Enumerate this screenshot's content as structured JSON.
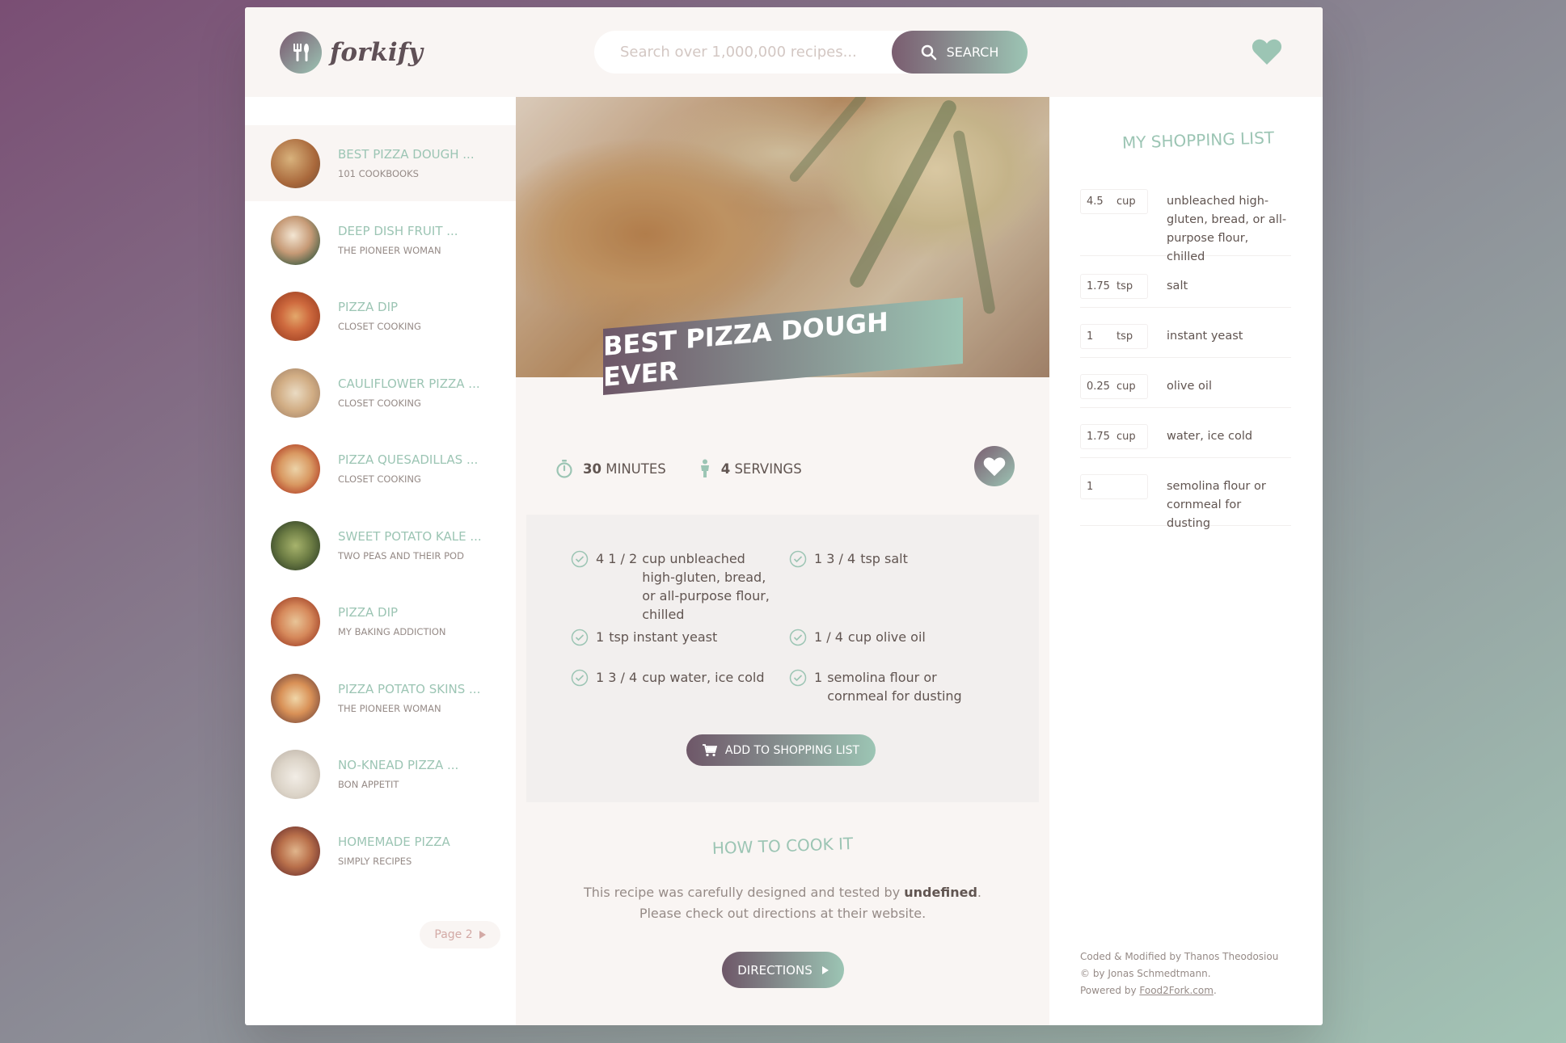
{
  "header": {
    "logo_text": "forkify",
    "search_placeholder": "Search over 1,000,000 recipes...",
    "search_label": "SEARCH"
  },
  "results": [
    {
      "title": "BEST PIZZA DOUGH ...",
      "publisher": "101 COOKBOOKS",
      "active": true
    },
    {
      "title": "DEEP DISH FRUIT ...",
      "publisher": "THE PIONEER WOMAN"
    },
    {
      "title": "PIZZA DIP",
      "publisher": "CLOSET COOKING"
    },
    {
      "title": "CAULIFLOWER PIZZA ...",
      "publisher": "CLOSET COOKING"
    },
    {
      "title": "PIZZA QUESADILLAS ...",
      "publisher": "CLOSET COOKING"
    },
    {
      "title": "SWEET POTATO KALE ...",
      "publisher": "TWO PEAS AND THEIR POD"
    },
    {
      "title": "PIZZA DIP",
      "publisher": "MY BAKING ADDICTION"
    },
    {
      "title": "PIZZA POTATO SKINS ...",
      "publisher": "THE PIONEER WOMAN"
    },
    {
      "title": "NO-KNEAD PIZZA ...",
      "publisher": "BON APPETIT"
    },
    {
      "title": "HOMEMADE PIZZA",
      "publisher": "SIMPLY RECIPES"
    }
  ],
  "pagination": {
    "label": "Page 2"
  },
  "recipe": {
    "title": "BEST PIZZA DOUGH EVER",
    "time_value": "30",
    "time_unit": "MINUTES",
    "servings_value": "4",
    "servings_unit": "SERVINGS",
    "ingredients": [
      {
        "qty": "4 1 / 2",
        "text": "cup unbleached high-gluten, bread, or all-purpose flour, chilled"
      },
      {
        "qty": "1 3 / 4",
        "text": "tsp salt"
      },
      {
        "qty": "1",
        "text": "tsp instant yeast"
      },
      {
        "qty": "1 / 4",
        "text": "cup olive oil"
      },
      {
        "qty": "1 3 / 4",
        "text": "cup water, ice cold"
      },
      {
        "qty": "1",
        "text": "semolina flour or cornmeal for dusting"
      }
    ],
    "add_to_list_label": "ADD TO SHOPPING LIST",
    "directions_heading": "HOW TO COOK IT",
    "directions_text_1": "This recipe was carefully designed and tested by",
    "directions_author": "undefined",
    "directions_text_2": ".",
    "directions_text_3": "Please check out directions at their website.",
    "directions_label": "DIRECTIONS"
  },
  "shopping": {
    "title": "MY SHOPPING LIST",
    "items": [
      {
        "count": "4.5",
        "unit": "cup",
        "text": "unbleached high-gluten, bread, or all-purpose flour, chilled"
      },
      {
        "count": "1.75",
        "unit": "tsp",
        "text": "salt"
      },
      {
        "count": "1",
        "unit": "tsp",
        "text": "instant yeast"
      },
      {
        "count": "0.25",
        "unit": "cup",
        "text": "olive oil"
      },
      {
        "count": "1.75",
        "unit": "cup",
        "text": "water, ice cold"
      },
      {
        "count": "1",
        "unit": "",
        "text": "semolina flour or cornmeal for dusting"
      }
    ]
  },
  "footer": {
    "line1": "Coded & Modified by Thanos Theodosiou",
    "line2": "© by Jonas Schmedtmann.",
    "line3_prefix": "Powered by ",
    "line3_link": "Food2Fork.com",
    "line3_suffix": "."
  },
  "colors": {
    "accent": "#9cc5b4",
    "primary": "#7a5d70",
    "text": "#615551",
    "bg_light": "#f9f5f3"
  }
}
